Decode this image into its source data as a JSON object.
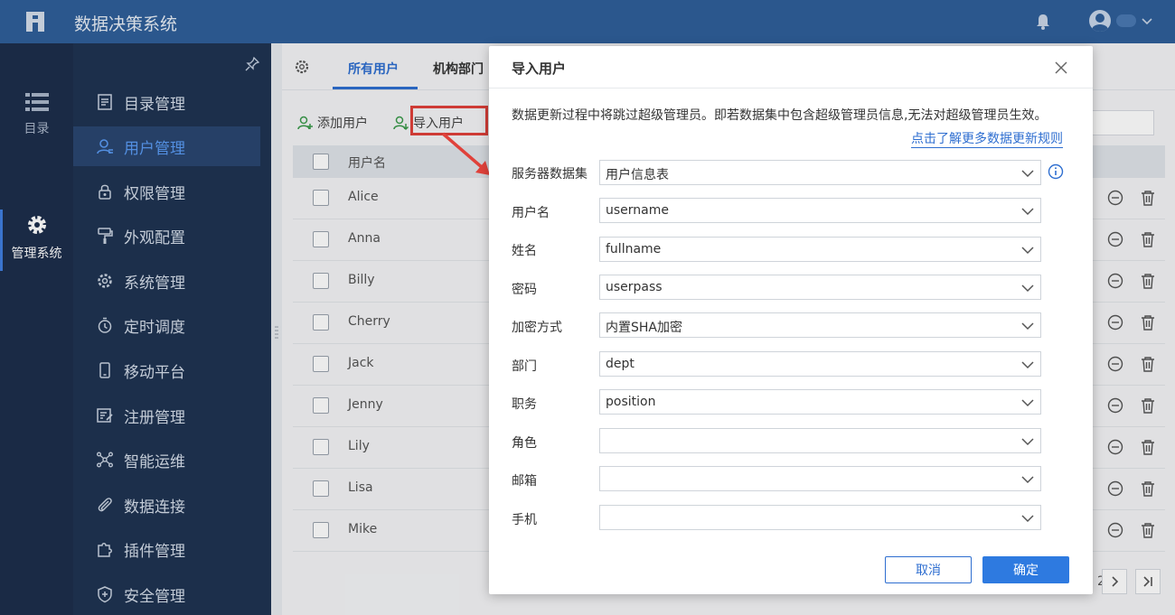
{
  "app": {
    "title": "数据决策系统"
  },
  "rail": {
    "items": [
      {
        "label": "目录"
      },
      {
        "label": "管理系统"
      }
    ]
  },
  "sidebar": {
    "items": [
      {
        "label": "目录管理",
        "icon": "directory-icon"
      },
      {
        "label": "用户管理",
        "icon": "user-icon"
      },
      {
        "label": "权限管理",
        "icon": "lock-icon"
      },
      {
        "label": "外观配置",
        "icon": "paint-roller-icon"
      },
      {
        "label": "系统管理",
        "icon": "gear-icon"
      },
      {
        "label": "定时调度",
        "icon": "timer-icon"
      },
      {
        "label": "移动平台",
        "icon": "mobile-icon"
      },
      {
        "label": "注册管理",
        "icon": "register-icon"
      },
      {
        "label": "智能运维",
        "icon": "network-icon"
      },
      {
        "label": "数据连接",
        "icon": "paperclip-icon"
      },
      {
        "label": "插件管理",
        "icon": "puzzle-icon"
      },
      {
        "label": "安全管理",
        "icon": "shield-icon"
      }
    ]
  },
  "tabs": [
    {
      "label": "所有用户"
    },
    {
      "label": "机构部门"
    }
  ],
  "toolbar": {
    "add_label": "添加用户",
    "import_label": "导入用户"
  },
  "table": {
    "header": "用户名",
    "rows": [
      "Alice",
      "Anna",
      "Billy",
      "Cherry",
      "Jack",
      "Jenny",
      "Lily",
      "Lisa",
      "Mike"
    ]
  },
  "pager": {
    "page": "2"
  },
  "dialog": {
    "title": "导入用户",
    "notice": "数据更新过程中将跳过超级管理员。即若数据集中包含超级管理员信息,无法对超级管理员生效。",
    "link": "点击了解更多数据更新规则",
    "fields": [
      {
        "label": "服务器数据集",
        "value": "用户信息表"
      },
      {
        "label": "用户名",
        "value": "username"
      },
      {
        "label": "姓名",
        "value": "fullname"
      },
      {
        "label": "密码",
        "value": "userpass"
      },
      {
        "label": "加密方式",
        "value": "内置SHA加密"
      },
      {
        "label": "部门",
        "value": "dept"
      },
      {
        "label": "职务",
        "value": "position"
      },
      {
        "label": "角色",
        "value": ""
      },
      {
        "label": "邮箱",
        "value": ""
      },
      {
        "label": "手机",
        "value": ""
      }
    ],
    "cancel_label": "取消",
    "ok_label": "确定"
  },
  "colors": {
    "header_bg": "#2f5f9a",
    "sidebar_bg": "#1f3352",
    "rail_bg": "#1d2e4b",
    "accent": "#2e6ed0",
    "highlight": "#e0413a"
  }
}
